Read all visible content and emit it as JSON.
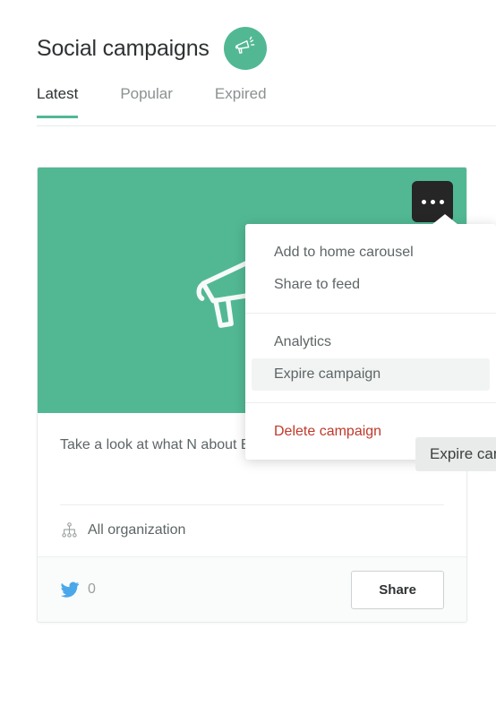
{
  "header": {
    "title": "Social campaigns",
    "badge_icon": "megaphone-icon"
  },
  "tabs": [
    {
      "label": "Latest",
      "active": true
    },
    {
      "label": "Popular",
      "active": false
    },
    {
      "label": "Expired",
      "active": false
    }
  ],
  "card": {
    "hero_icon": "megaphone-icon",
    "menu_button_icon": "ellipsis-icon",
    "body_text": "Take a look at what N                about Best Co.!",
    "organization": {
      "icon": "org-chart-icon",
      "label": "All organization"
    },
    "footer": {
      "network_icon": "twitter-icon",
      "share_count": "0",
      "share_label": "Share"
    }
  },
  "dropdown": {
    "groups": [
      {
        "items": [
          {
            "label": "Add to home carousel",
            "state": "normal"
          },
          {
            "label": "Share to feed",
            "state": "normal"
          }
        ]
      },
      {
        "items": [
          {
            "label": "Analytics",
            "state": "normal"
          },
          {
            "label": "Expire campaign",
            "state": "highlighted"
          }
        ]
      },
      {
        "items": [
          {
            "label": "Delete campaign",
            "state": "danger"
          }
        ]
      }
    ]
  },
  "tooltip": {
    "text": "Expire campaign"
  },
  "colors": {
    "accent": "#52b894",
    "danger": "#c0392b",
    "text": "#5e6566",
    "heading": "#2f3233",
    "twitter": "#4aa7ea"
  }
}
